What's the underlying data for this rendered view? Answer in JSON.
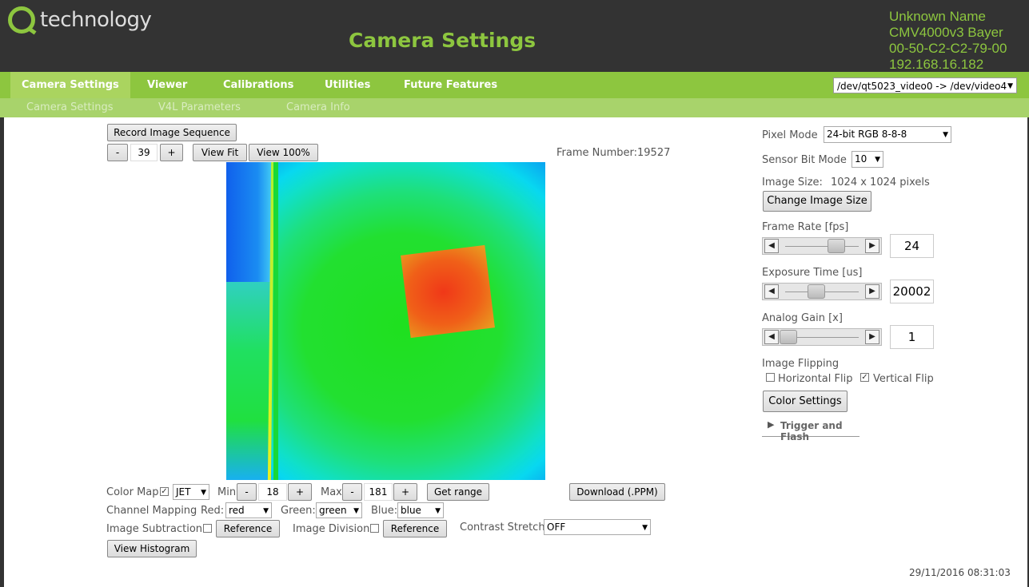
{
  "header": {
    "logo_text": "technology",
    "page_title": "Camera Settings",
    "device_name": "Unknown Name",
    "sensor": "CMV4000v3 Bayer",
    "mac": "00-50-C2-C2-79-00",
    "ip": "192.168.16.182"
  },
  "nav": {
    "tabs": [
      "Camera Settings",
      "Viewer",
      "Calibrations",
      "Utilities",
      "Future Features"
    ],
    "active_tab": "Camera Settings",
    "device_select": "/dev/qt5023_video0 -> /dev/video4",
    "subtabs": [
      "Camera Settings",
      "V4L Parameters",
      "Camera Info"
    ]
  },
  "viewer": {
    "record_label": "Record Image Sequence",
    "zoom_minus": "-",
    "zoom_value": "39",
    "zoom_plus": "+",
    "view_fit": "View Fit",
    "view_100": "View 100%",
    "frame_number": "Frame Number:19527"
  },
  "controls": {
    "color_map_label": "Color Map",
    "color_map_checked": true,
    "color_map_value": "JET",
    "min_label": "Min",
    "min_value": "18",
    "max_label": "Max",
    "max_value": "181",
    "minus": "-",
    "plus": "+",
    "get_range": "Get range",
    "download": "Download (.PPM)",
    "channel_mapping_label": "Channel Mapping",
    "red_label": "Red:",
    "red_value": "red",
    "green_label": "Green:",
    "green_value": "green",
    "blue_label": "Blue:",
    "blue_value": "blue",
    "image_subtraction_label": "Image Subtraction",
    "reference": "Reference",
    "image_division_label": "Image Division",
    "contrast_stretch_label": "Contrast Stretch",
    "contrast_stretch_value": "OFF",
    "view_histogram": "View Histogram"
  },
  "settings": {
    "pixel_mode_label": "Pixel Mode",
    "pixel_mode_value": "24-bit RGB 8-8-8",
    "sensor_bit_mode_label": "Sensor Bit Mode",
    "sensor_bit_mode_value": "10",
    "image_size_label": "Image Size:",
    "image_size_value": "1024 x 1024 pixels",
    "change_image_size": "Change Image Size",
    "frame_rate_label": "Frame Rate [fps]",
    "frame_rate_value": "24",
    "frame_rate_level": 0.72,
    "exposure_label": "Exposure Time [us]",
    "exposure_value": "20002",
    "exposure_level": 0.42,
    "gain_label": "Analog Gain [x]",
    "gain_value": "1",
    "gain_level": 0.0,
    "image_flipping_label": "Image Flipping",
    "horizontal_flip_label": "Horizontal Flip",
    "horizontal_flip": false,
    "vertical_flip_label": "Vertical Flip",
    "vertical_flip": true,
    "color_settings": "Color Settings",
    "trigger_flash": "Trigger and Flash"
  },
  "footer": {
    "timestamp": "29/11/2016 08:31:03"
  },
  "colors": {
    "accent": "#8dc63f",
    "header_bg": "#333333"
  }
}
